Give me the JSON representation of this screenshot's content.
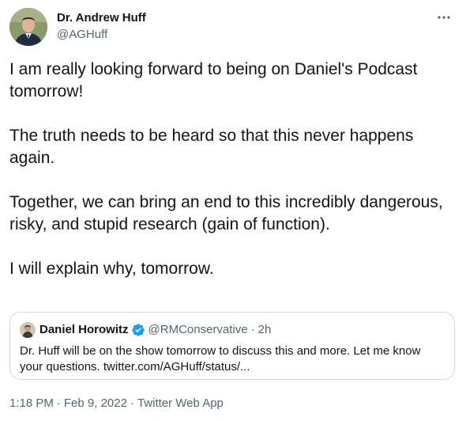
{
  "author": {
    "name": "Dr. Andrew Huff",
    "handle": "@AGHuff"
  },
  "tweet": {
    "paragraphs": [
      "I am really looking forward to being on Daniel's Podcast tomorrow!",
      "The truth needs to be heard so that this never happens again.",
      "Together, we can bring an end to this incredibly dangerous, risky, and stupid research (gain of function).",
      "I will explain why, tomorrow."
    ]
  },
  "quote": {
    "name": "Daniel Horowitz",
    "handle": "@RMConservative",
    "separator": "·",
    "time": "2h",
    "line1": "Dr. Huff will be on the show tomorrow to discuss this and more. Let me know",
    "line2": "your questions. twitter.com/AGHuff/status/..."
  },
  "meta": {
    "time": "1:18 PM",
    "separator": "·",
    "date": "Feb 9, 2022",
    "source": "Twitter Web App"
  },
  "icons": {
    "more": "more-dots-icon",
    "verified": "verified-badge-icon"
  },
  "colors": {
    "text": "#0f1419",
    "secondary": "#536471",
    "border": "#cfd9de",
    "verified": "#1d9bf0"
  }
}
